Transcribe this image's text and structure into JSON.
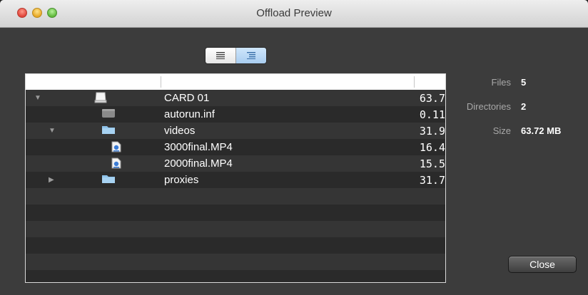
{
  "window": {
    "title": "Offload Preview"
  },
  "view_toggle": {
    "list_icon": "list-icon",
    "outline_icon": "outline-icon",
    "selected": "outline"
  },
  "table": {
    "rows": [
      {
        "name": "CARD 01",
        "size": "63.7",
        "icon": "drive-icon",
        "expander": "expanded"
      },
      {
        "name": "autorun.inf",
        "size": "0.11",
        "icon": "file-icon",
        "expander": "none"
      },
      {
        "name": "videos",
        "size": "31.9",
        "icon": "folder-icon",
        "expander": "expanded"
      },
      {
        "name": "3000final.MP4",
        "size": "16.4",
        "icon": "video-file-icon",
        "expander": "none"
      },
      {
        "name": "2000final.MP4",
        "size": "15.5",
        "icon": "video-file-icon",
        "expander": "none"
      },
      {
        "name": "proxies",
        "size": "31.7",
        "icon": "folder-icon",
        "expander": "collapsed"
      }
    ]
  },
  "info": {
    "files_label": "Files",
    "files_value": "5",
    "directories_label": "Directories",
    "directories_value": "2",
    "size_label": "Size",
    "size_value": "63.72 MB"
  },
  "buttons": {
    "close": "Close"
  }
}
